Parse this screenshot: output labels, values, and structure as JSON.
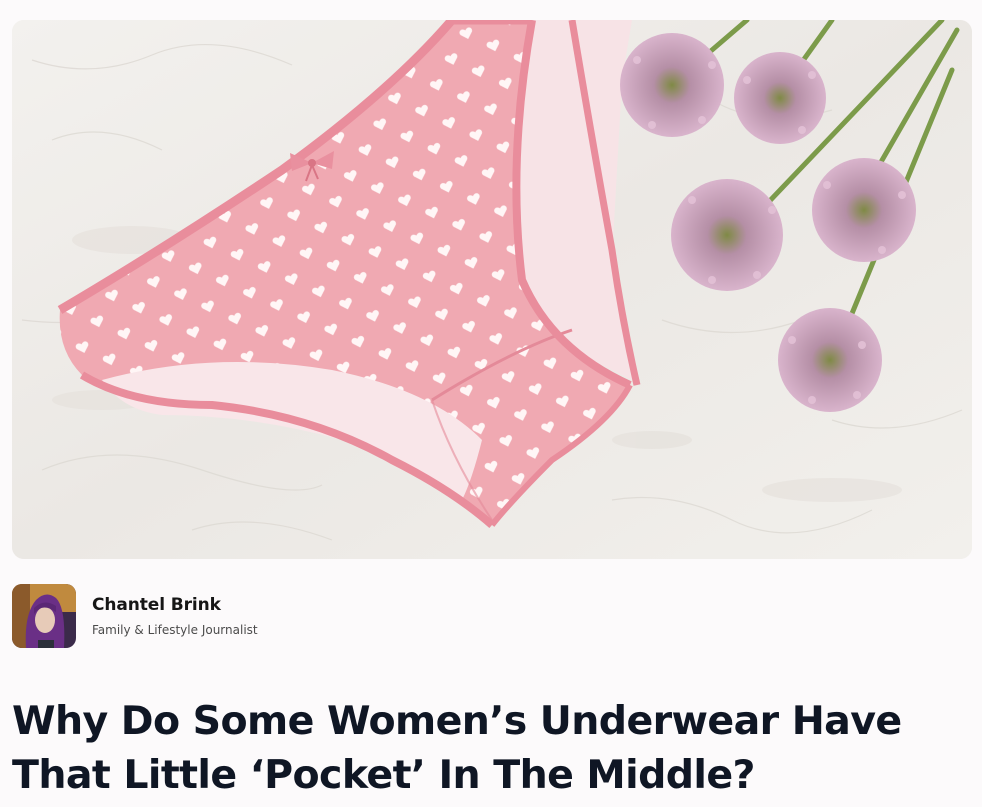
{
  "hero": {
    "image": "pink-heart-print-panties-with-allium-flowers"
  },
  "author": {
    "avatar": "author-avatar-photo",
    "name": "Chantel Brink",
    "role": "Family & Lifestyle Journalist"
  },
  "article": {
    "title": "Why Do Some Women’s Underwear Have That Little ‘Pocket’ In The Middle?"
  },
  "colors": {
    "page_bg": "#fcfafb",
    "title": "#0f1624",
    "fabric_pink": "#f0a9b2",
    "trim_pink": "#e98d9c",
    "background_plaster": "#efedea"
  }
}
